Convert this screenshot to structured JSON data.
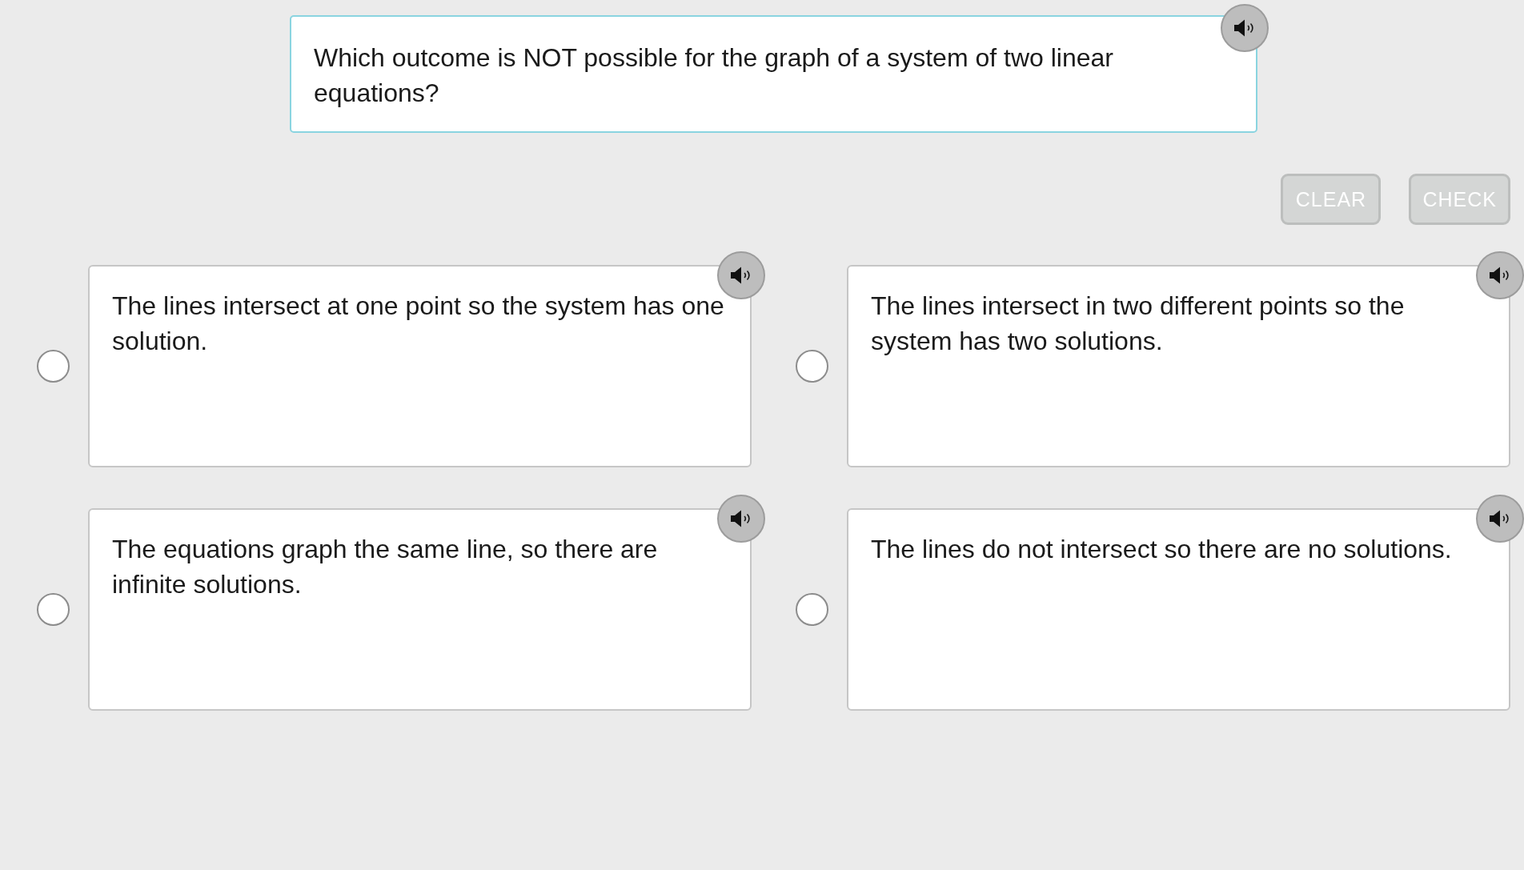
{
  "question": {
    "text": "Which outcome is NOT possible for the graph of a system of two linear equations?"
  },
  "buttons": [
    {
      "label": "CLEAR",
      "disabled": true
    },
    {
      "label": "CHECK",
      "disabled": true
    }
  ],
  "answers": [
    {
      "text": "The lines intersect at one point so the system has one solution.",
      "selected": false
    },
    {
      "text": "The lines intersect in two different points so the system has two solutions.",
      "selected": false
    },
    {
      "text": "The equations graph the same line, so there are infinite solutions.",
      "selected": false
    },
    {
      "text": "The lines do not intersect so there are no solutions.",
      "selected": false
    }
  ]
}
